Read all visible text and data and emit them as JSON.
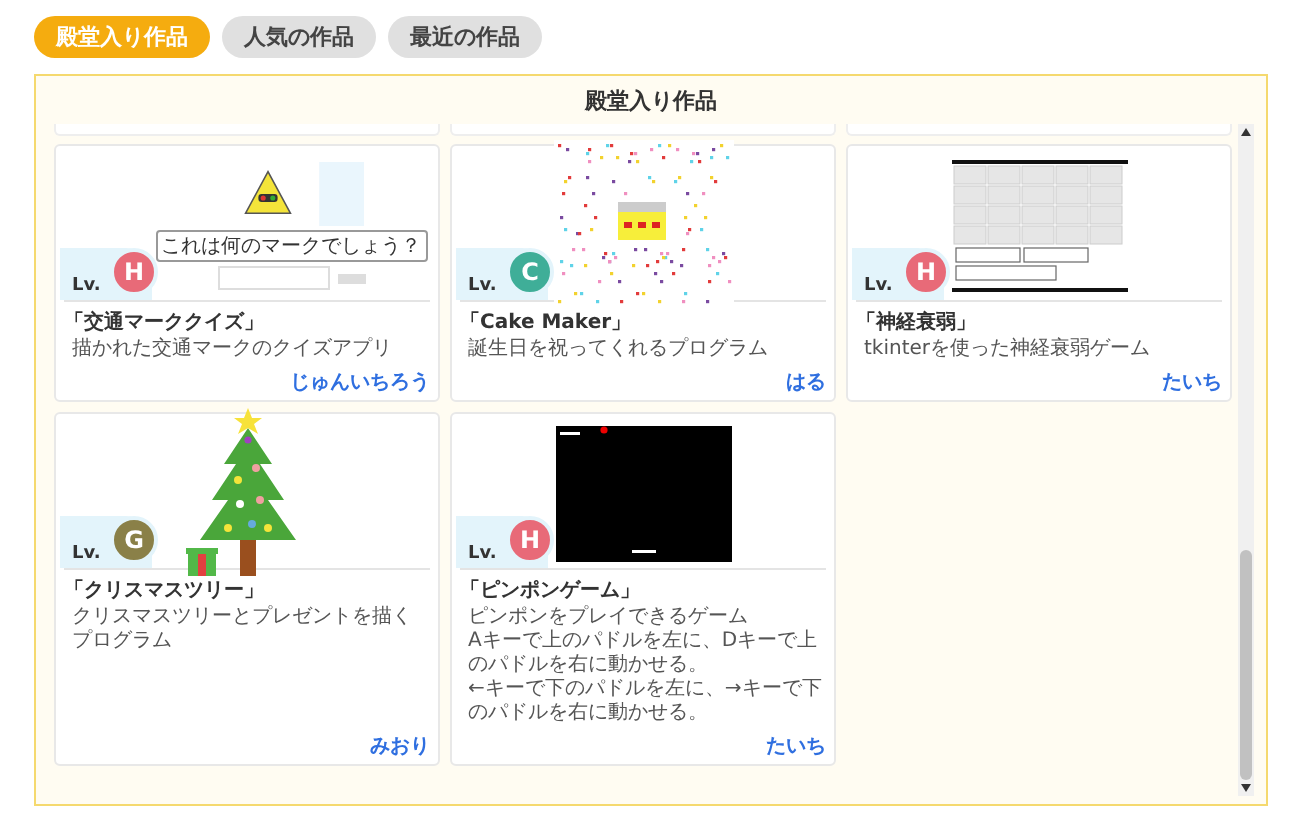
{
  "tabs": [
    {
      "label": "殿堂入り作品",
      "selected": true
    },
    {
      "label": "人気の作品",
      "selected": false
    },
    {
      "label": "最近の作品",
      "selected": false
    }
  ],
  "panel": {
    "title": "殿堂入り作品",
    "cards": [
      {
        "kind": "quiz",
        "level_label": "Lv.",
        "avatar": {
          "letter": "H",
          "color": "#e86a78"
        },
        "title": "「交通マーククイズ」",
        "description": "描かれた交通マークのクイズアプリ",
        "author": "じゅんいちろう",
        "quiz_prompt": "これは何のマークでしょう？"
      },
      {
        "kind": "cake",
        "level_label": "Lv.",
        "avatar": {
          "letter": "C",
          "color": "#3fae98"
        },
        "title": "「Cake Maker」",
        "description": "誕生日を祝ってくれるプログラム",
        "author": "はる"
      },
      {
        "kind": "grid",
        "level_label": "Lv.",
        "avatar": {
          "letter": "H",
          "color": "#e86a78"
        },
        "title": "「神経衰弱」",
        "description": "tkinterを使った神経衰弱ゲーム",
        "author": "たいち"
      },
      {
        "kind": "tree",
        "level_label": "Lv.",
        "avatar": {
          "letter": "G",
          "color": "#8a8048"
        },
        "title": "「クリスマスツリー」",
        "description": "クリスマスツリーとプレゼントを描くプログラム",
        "author": "みおり"
      },
      {
        "kind": "pong",
        "level_label": "Lv.",
        "avatar": {
          "letter": "H",
          "color": "#e86a78"
        },
        "title": "「ピンポンゲーム」",
        "description": "ピンポンをプレイできるゲーム\nAキーで上のパドルを左に、Dキーで上のパドルを右に動かせる。\n←キーで下のパドルを左に、→キーで下のパドルを右に動かせる。",
        "author": "たいち"
      }
    ]
  }
}
